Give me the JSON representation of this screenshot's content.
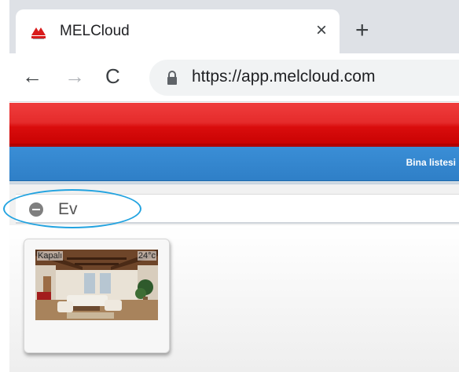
{
  "browser": {
    "tab": {
      "title": "MELCloud",
      "close_glyph": "×",
      "favicon": "melcloud-logo-icon"
    },
    "new_tab_glyph": "+",
    "nav": {
      "back_glyph": "←",
      "forward_glyph": "→",
      "reload_glyph": "C"
    },
    "address": {
      "url": "https://app.melcloud.com",
      "icon": "lock-icon"
    }
  },
  "page": {
    "nav_bar": {
      "building_list_label": "Bina listesi"
    },
    "group": {
      "name": "Ev",
      "icon": "collapse-minus-icon"
    },
    "unit": {
      "status": "Kapalı",
      "temperature": "24°c"
    },
    "colors": {
      "header_red": "#e0191a",
      "nav_blue": "#2f7fc7",
      "highlight": "#22a3e0"
    }
  }
}
